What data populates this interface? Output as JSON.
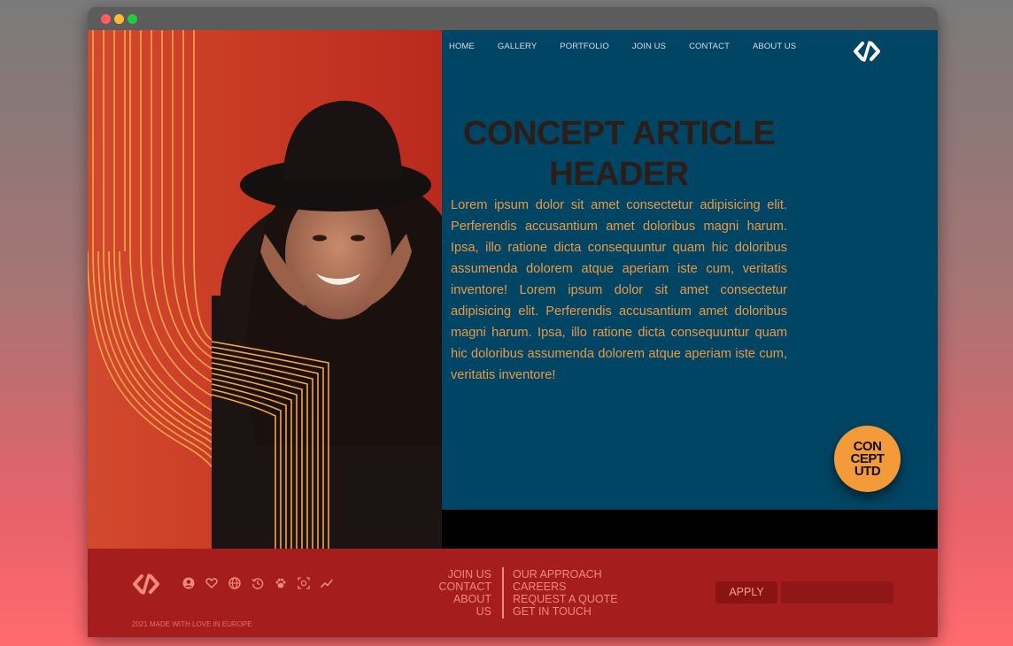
{
  "nav": {
    "items": [
      "HOME",
      "GALLERY",
      "PORTFOLIO",
      "JOIN US",
      "CONTACT",
      "ABOUT US"
    ]
  },
  "hero": {
    "headline": "CONCEPT ARTICLE HEADER",
    "body": "Lorem ipsum dolor sit amet consectetur adipisicing elit. Perferendis accusantium amet doloribus magni harum. Ipsa, illo ratione dicta consequuntur quam hic doloribus assumenda dolorem atque aperiam iste cum, veritatis inventore! Lorem ipsum dolor sit amet consectetur adipisicing elit. Perferendis accusantium amet doloribus magni harum. Ipsa, illo ratione dicta consequuntur quam hic doloribus assumenda dolorem atque aperiam iste cum, veritatis inventore!",
    "badge_lines": [
      "CON",
      "CEPT",
      "UTD"
    ]
  },
  "footer": {
    "links_left": [
      "JOIN US",
      "CONTACT",
      "ABOUT",
      "US"
    ],
    "links_right": [
      "OUR APPROACH",
      "CAREERS",
      "REQUEST A QUOTE",
      "GET IN TOUCH"
    ],
    "apply_label": "APPLY",
    "apply_input_value": "",
    "copyright": "2021 MADE WITH LOVE IN EUROPE",
    "icons": [
      "user-circle-icon",
      "heart-icon",
      "globe-icon",
      "history-icon",
      "paw-icon",
      "focus-icon",
      "trend-icon"
    ]
  },
  "colors": {
    "hero_blue": "#004563",
    "accent_orange": "#f39a3a",
    "footer_red": "#a51d1d",
    "hero_red": "#c93a24"
  }
}
